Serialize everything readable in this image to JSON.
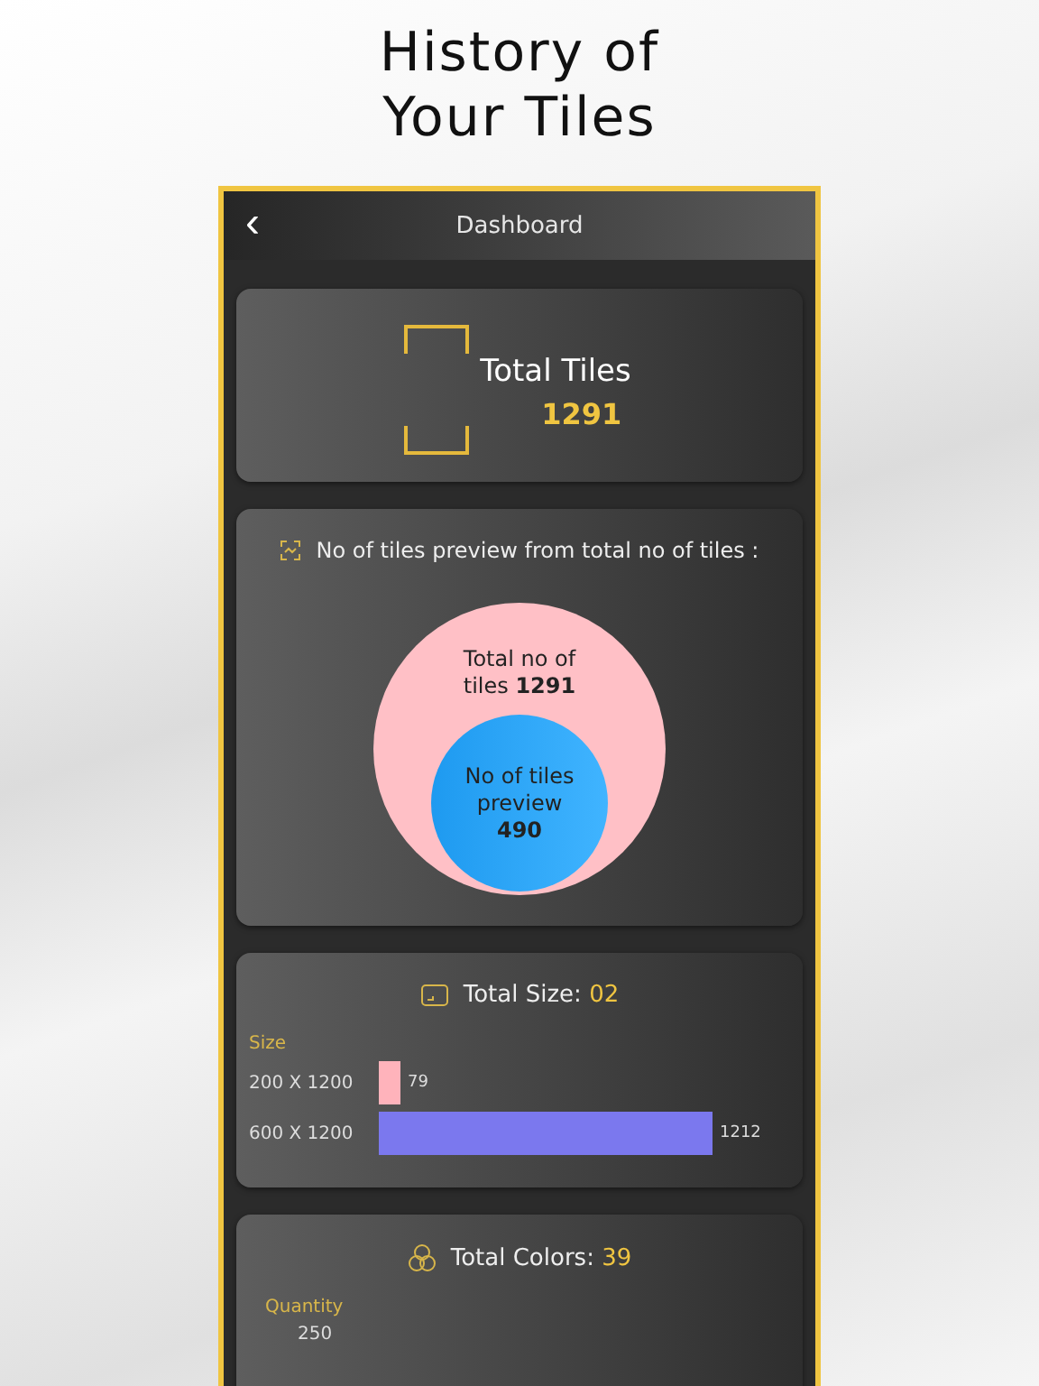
{
  "headline": [
    "History of",
    "Your Tiles"
  ],
  "header": {
    "back": "‹",
    "title": "Dashboard"
  },
  "total_tiles": {
    "label": "Total Tiles",
    "value": "1291"
  },
  "preview": {
    "title": "No of tiles preview from total no of tiles :",
    "outer": "Total no of tiles **1291**",
    "inner": "No of tiles preview **490**"
  },
  "sizes": {
    "title": "Total Size: ",
    "count": "02",
    "axis_label": "Size",
    "chart_data": {
      "type": "bar",
      "orientation": "horizontal",
      "categories": [
        "200 X 1200",
        "600 X 1200"
      ],
      "values": [
        79,
        1212
      ],
      "data_labels": true
    }
  },
  "colors": {
    "title": "Total Colors: ",
    "count": "39",
    "axis_label": "Quantity",
    "tick": "250"
  }
}
